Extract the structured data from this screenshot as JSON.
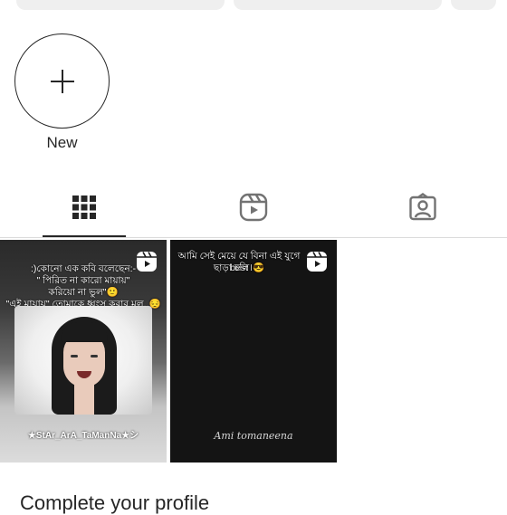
{
  "highlights": {
    "new_label": "New"
  },
  "tabs": [
    {
      "name": "posts-grid",
      "active": true
    },
    {
      "name": "reels",
      "active": false
    },
    {
      "name": "tagged",
      "active": false
    }
  ],
  "posts": [
    {
      "caption_lines": [
        ":)কোনো এক কবি বলেছেন:-",
        "\" পিরিত না কারো মায়ায়\"",
        "করিয়ো না ভুল\"🙂",
        "\"এই মায়ায়\" তোমাকে ধ্বংস করার মূল..😔💔"
      ],
      "footer": "★StAr_ArA_TaManNa★シ"
    },
    {
      "caption_lines": [
        "আমি সেই মেয়ে যে বিনা এই যুগে best",
        "ছাড়া চলি।😎"
      ],
      "signature": "Ami tomaneena"
    }
  ],
  "profile": {
    "complete_title": "Complete your profile"
  },
  "colors": {
    "text": "#262626",
    "divider": "#dbdbdb",
    "button_bg": "#efefef"
  }
}
